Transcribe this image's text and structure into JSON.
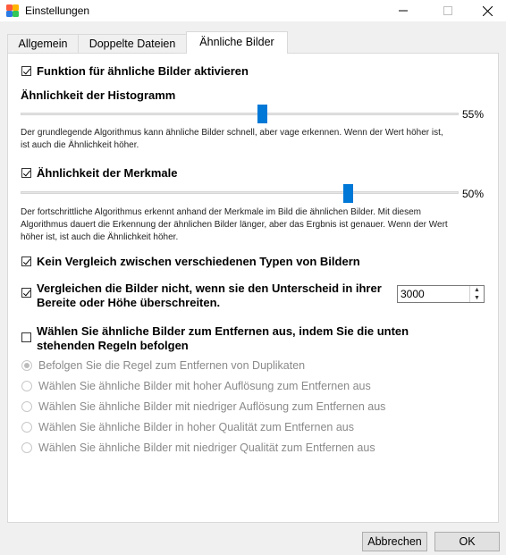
{
  "window": {
    "title": "Einstellungen",
    "app_icon": "app-logo-icon"
  },
  "tabs": [
    {
      "label": "Allgemein",
      "active": false
    },
    {
      "label": "Doppelte Dateien",
      "active": false
    },
    {
      "label": "Ähnliche Bilder",
      "active": true
    }
  ],
  "enable_feature": {
    "label": "Funktion für ähnliche Bilder aktivieren",
    "checked": true
  },
  "histogram": {
    "heading": "Ähnlichkeit der Histogramm",
    "value": 55,
    "value_label": "55%",
    "hint_line1": "Der grundlegende Algorithmus kann ähnliche Bilder schnell, aber vage erkennen. Wenn der Wert höher ist,",
    "hint_line2": "ist auch die Ähnlichkeit höher."
  },
  "features": {
    "label": "Ähnlichkeit der Merkmale",
    "checked": true,
    "value": 50,
    "value_label": "50%",
    "hint_line1": "Der fortschrittliche Algorithmus erkennt anhand der Merkmale im Bild die ähnlichen Bilder. Mit diesem",
    "hint_line2": "Algorithmus  dauert die Erkennung der ähnlichen Bilder länger, aber das Ergbnis ist genauer. Wenn der Wert",
    "hint_line3": "höher ist, ist auch die Ähnlichkeit höher."
  },
  "no_compare_types": {
    "label": "Kein Vergleich zwischen verschiedenen Typen von Bildern",
    "checked": true
  },
  "size_diff": {
    "label_line1": "Vergleichen die Bilder nicht, wenn sie den Unterscheid in ihrer",
    "label_line2": "Bereite oder Höhe überschreiten.",
    "checked": true,
    "value": "3000"
  },
  "auto_select": {
    "label_line1": "Wählen Sie ähnliche Bilder zum Entfernen aus, indem Sie die unten",
    "label_line2": "stehenden Regeln befolgen",
    "checked": false
  },
  "rules": [
    {
      "label": "Befolgen Sie die Regel zum Entfernen von Duplikaten",
      "selected": true
    },
    {
      "label": "Wählen Sie ähnliche Bilder mit hoher Auflösung zum Entfernen aus",
      "selected": false
    },
    {
      "label": "Wählen Sie ähnliche Bilder mit niedriger Auflösung zum Entfernen aus",
      "selected": false
    },
    {
      "label": "Wählen Sie ähnliche Bilder in hoher Qualität zum Entfernen aus",
      "selected": false
    },
    {
      "label": "Wählen Sie ähnliche Bilder mit niedriger Qualität zum Entfernen aus",
      "selected": false
    }
  ],
  "footer": {
    "cancel_label": "Abbrechen",
    "ok_label": "OK"
  },
  "colors": {
    "accent": "#0078d7",
    "window_bg": "#f0f0f0",
    "panel_bg": "#ffffff"
  }
}
